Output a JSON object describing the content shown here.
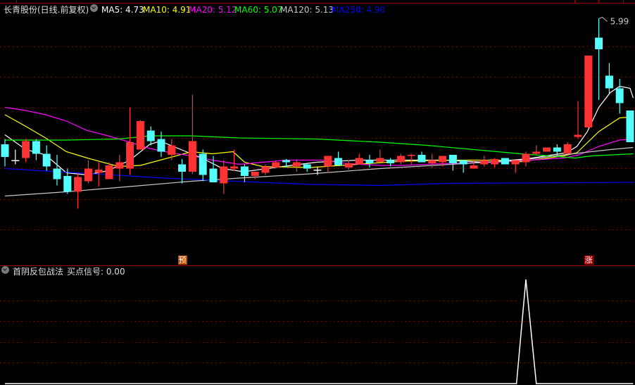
{
  "header": {
    "title": "长青股份(日线.前复权)",
    "ma": [
      {
        "label": "MA5: 4.73",
        "color": "#ffffff"
      },
      {
        "label": "MA10: 4.91",
        "color": "#ffff00"
      },
      {
        "label": "MA20: 5.12",
        "color": "#ff00ff"
      },
      {
        "label": "MA60: 5.07",
        "color": "#00ff00"
      },
      {
        "label": "MA120: 5.13",
        "color": "#c8c8c8"
      },
      {
        "label": "MA250: 4.90",
        "color": "#0000ff"
      }
    ]
  },
  "indicator": {
    "name": "首阴反包战法",
    "value_label": "买点信号: 0.00"
  },
  "markers": {
    "yu": "预",
    "zhang": "涨"
  },
  "colors": {
    "up": "#ff3333",
    "down": "#54ffff",
    "grid": "#8b0000",
    "border": "#a00000"
  },
  "chart_data": [
    {
      "type": "candlestick",
      "title": "长青股份(日线.前复权)",
      "ylim": [
        4.0,
        6.0
      ],
      "max_label": "5.99",
      "ohlc_order": [
        "open",
        "high",
        "low",
        "close"
      ],
      "candles": [
        [
          4.8,
          4.85,
          4.59,
          4.68
        ],
        [
          4.65,
          4.75,
          4.61,
          4.65
        ],
        [
          4.67,
          4.85,
          4.63,
          4.83
        ],
        [
          4.83,
          4.85,
          4.65,
          4.71
        ],
        [
          4.71,
          4.79,
          4.55,
          4.59
        ],
        [
          4.57,
          4.7,
          4.41,
          4.47
        ],
        [
          4.5,
          4.57,
          4.33,
          4.35
        ],
        [
          4.35,
          4.52,
          4.19,
          4.49
        ],
        [
          4.45,
          4.65,
          4.43,
          4.57
        ],
        [
          4.53,
          4.63,
          4.4,
          4.56
        ],
        [
          4.47,
          4.63,
          4.47,
          4.6
        ],
        [
          4.57,
          4.7,
          4.45,
          4.63
        ],
        [
          4.57,
          5.15,
          4.51,
          4.82
        ],
        [
          4.75,
          5.03,
          4.75,
          5.02
        ],
        [
          4.93,
          4.97,
          4.79,
          4.83
        ],
        [
          4.85,
          4.92,
          4.68,
          4.73
        ],
        [
          4.7,
          4.85,
          4.65,
          4.79
        ],
        [
          4.61,
          4.66,
          4.43,
          4.54
        ],
        [
          4.54,
          5.27,
          4.52,
          4.83
        ],
        [
          4.71,
          4.75,
          4.45,
          4.51
        ],
        [
          4.57,
          4.69,
          4.44,
          4.44
        ],
        [
          4.43,
          4.65,
          4.33,
          4.59
        ],
        [
          4.57,
          4.75,
          4.55,
          4.59
        ],
        [
          4.59,
          4.61,
          4.44,
          4.5
        ],
        [
          4.5,
          4.54,
          4.47,
          4.54
        ],
        [
          4.53,
          4.61,
          4.51,
          4.59
        ],
        [
          4.58,
          4.65,
          4.58,
          4.63
        ],
        [
          4.65,
          4.66,
          4.58,
          4.63
        ],
        [
          4.59,
          4.66,
          4.54,
          4.63
        ],
        [
          4.61,
          4.62,
          4.54,
          4.57
        ],
        [
          4.56,
          4.59,
          4.51,
          4.56
        ],
        [
          4.59,
          4.69,
          4.53,
          4.69
        ],
        [
          4.67,
          4.73,
          4.6,
          4.6
        ],
        [
          4.58,
          4.65,
          4.56,
          4.62
        ],
        [
          4.61,
          4.71,
          4.61,
          4.67
        ],
        [
          4.65,
          4.7,
          4.58,
          4.62
        ],
        [
          4.63,
          4.75,
          4.63,
          4.67
        ],
        [
          4.65,
          4.67,
          4.59,
          4.62
        ],
        [
          4.63,
          4.71,
          4.61,
          4.69
        ],
        [
          4.69,
          4.71,
          4.61,
          4.7
        ],
        [
          4.7,
          4.73,
          4.63,
          4.63
        ],
        [
          4.62,
          4.71,
          4.58,
          4.65
        ],
        [
          4.63,
          4.69,
          4.59,
          4.69
        ],
        [
          4.7,
          4.7,
          4.55,
          4.62
        ],
        [
          4.65,
          4.65,
          4.53,
          4.61
        ],
        [
          4.57,
          4.65,
          4.57,
          4.6
        ],
        [
          4.61,
          4.69,
          4.59,
          4.65
        ],
        [
          4.61,
          4.67,
          4.58,
          4.66
        ],
        [
          4.67,
          4.67,
          4.61,
          4.61
        ],
        [
          4.61,
          4.65,
          4.53,
          4.65
        ],
        [
          4.63,
          4.73,
          4.59,
          4.71
        ],
        [
          4.71,
          4.79,
          4.7,
          4.73
        ],
        [
          4.73,
          4.77,
          4.73,
          4.77
        ],
        [
          4.77,
          4.8,
          4.69,
          4.73
        ],
        [
          4.71,
          4.82,
          4.71,
          4.8
        ],
        [
          4.87,
          5.21,
          4.85,
          4.89
        ],
        [
          4.96,
          5.64,
          4.95,
          5.64
        ],
        [
          5.81,
          5.99,
          5.22,
          5.7
        ],
        [
          5.45,
          5.57,
          5.28,
          5.33
        ],
        [
          5.33,
          5.42,
          5.09,
          5.19
        ],
        [
          5.12,
          5.12,
          4.82,
          4.82
        ]
      ],
      "series": [
        {
          "name": "MA5",
          "color": "#ffffff",
          "points": [
            [
              0,
              4.89
            ],
            [
              2,
              4.75
            ],
            [
              3.9,
              4.7
            ],
            [
              5.9,
              4.53
            ],
            [
              7.9,
              4.51
            ],
            [
              9.9,
              4.55
            ],
            [
              12,
              4.65
            ],
            [
              13.9,
              4.8
            ],
            [
              14.9,
              4.83
            ],
            [
              16.9,
              4.75
            ],
            [
              18.9,
              4.67
            ],
            [
              20.9,
              4.57
            ],
            [
              22.9,
              4.54
            ],
            [
              25.9,
              4.58
            ],
            [
              29.9,
              4.63
            ],
            [
              33.9,
              4.65
            ],
            [
              38,
              4.65
            ],
            [
              42.1,
              4.65
            ],
            [
              46.1,
              4.63
            ],
            [
              49.9,
              4.66
            ],
            [
              53.9,
              4.72
            ],
            [
              54.9,
              4.78
            ],
            [
              55.9,
              4.92
            ],
            [
              57,
              5.15
            ],
            [
              58.1,
              5.29
            ],
            [
              59,
              5.35
            ],
            [
              60,
              5.33
            ],
            [
              60.3,
              5.24
            ]
          ]
        },
        {
          "name": "MA10",
          "color": "#ffff00",
          "points": [
            [
              0,
              5.08
            ],
            [
              2,
              4.97
            ],
            [
              3.9,
              4.86
            ],
            [
              5.9,
              4.73
            ],
            [
              7.9,
              4.67
            ],
            [
              10.9,
              4.59
            ],
            [
              13,
              4.6
            ],
            [
              14.9,
              4.65
            ],
            [
              17.9,
              4.73
            ],
            [
              19.9,
              4.71
            ],
            [
              21.9,
              4.73
            ],
            [
              23,
              4.63
            ],
            [
              24.7,
              4.59
            ],
            [
              29.3,
              4.58
            ],
            [
              33.8,
              4.61
            ],
            [
              38.2,
              4.64
            ],
            [
              42.8,
              4.65
            ],
            [
              47.3,
              4.65
            ],
            [
              49.1,
              4.63
            ],
            [
              53.6,
              4.69
            ],
            [
              54.9,
              4.72
            ],
            [
              57,
              4.92
            ],
            [
              59,
              5.05
            ],
            [
              60.3,
              5.06
            ]
          ]
        },
        {
          "name": "MA20",
          "color": "#ff00ff",
          "points": [
            [
              0,
              5.15
            ],
            [
              2,
              5.12
            ],
            [
              3.9,
              5.08
            ],
            [
              5.9,
              5.02
            ],
            [
              7.9,
              4.93
            ],
            [
              9.9,
              4.88
            ],
            [
              12,
              4.82
            ],
            [
              13.9,
              4.76
            ],
            [
              15.9,
              4.72
            ],
            [
              17.9,
              4.69
            ],
            [
              19.9,
              4.65
            ],
            [
              22.5,
              4.61
            ],
            [
              27,
              4.65
            ],
            [
              30.4,
              4.65
            ],
            [
              32.6,
              4.62
            ],
            [
              36,
              4.6
            ],
            [
              38.2,
              4.6
            ],
            [
              42.8,
              4.62
            ],
            [
              47.3,
              4.63
            ],
            [
              53.6,
              4.67
            ],
            [
              55.1,
              4.7
            ],
            [
              57,
              4.78
            ],
            [
              59,
              4.84
            ],
            [
              60.3,
              4.85
            ]
          ]
        },
        {
          "name": "MA60",
          "color": "#00ff00",
          "points": [
            [
              0,
              4.84
            ],
            [
              5.9,
              4.84
            ],
            [
              10.9,
              4.85
            ],
            [
              13.9,
              4.88
            ],
            [
              17.9,
              4.88
            ],
            [
              22.5,
              4.86
            ],
            [
              29.9,
              4.85
            ],
            [
              36,
              4.82
            ],
            [
              40.5,
              4.79
            ],
            [
              45,
              4.75
            ],
            [
              49.5,
              4.71
            ],
            [
              53.6,
              4.68
            ],
            [
              54.7,
              4.67
            ],
            [
              56.3,
              4.69
            ],
            [
              60.3,
              4.71
            ]
          ]
        },
        {
          "name": "MA120",
          "color": "#c8c8c8",
          "points": [
            [
              0,
              4.31
            ],
            [
              5.9,
              4.35
            ],
            [
              12,
              4.4
            ],
            [
              17.9,
              4.45
            ],
            [
              22.5,
              4.48
            ],
            [
              29.3,
              4.52
            ],
            [
              36,
              4.57
            ],
            [
              42.8,
              4.61
            ],
            [
              49.5,
              4.65
            ],
            [
              53.6,
              4.7
            ],
            [
              58.1,
              4.75
            ],
            [
              60.3,
              4.77
            ]
          ]
        },
        {
          "name": "MA250",
          "color": "#0000ff",
          "points": [
            [
              0,
              4.57
            ],
            [
              8.5,
              4.52
            ],
            [
              15.3,
              4.48
            ],
            [
              22,
              4.45
            ],
            [
              29.3,
              4.42
            ],
            [
              36,
              4.41
            ],
            [
              42.8,
              4.43
            ],
            [
              60.3,
              4.44
            ]
          ]
        }
      ],
      "marker_indices": {
        "yu": 17,
        "zhang": 56
      }
    },
    {
      "type": "line",
      "title": "首阴反包战法",
      "series": [
        {
          "name": "买点信号",
          "color": "#ffffff",
          "points": [
            [
              0,
              0
            ],
            [
              49.1,
              0
            ],
            [
              50,
              1
            ],
            [
              51,
              0
            ],
            [
              60.3,
              0
            ]
          ]
        }
      ],
      "ylim": [
        0,
        1
      ]
    }
  ]
}
